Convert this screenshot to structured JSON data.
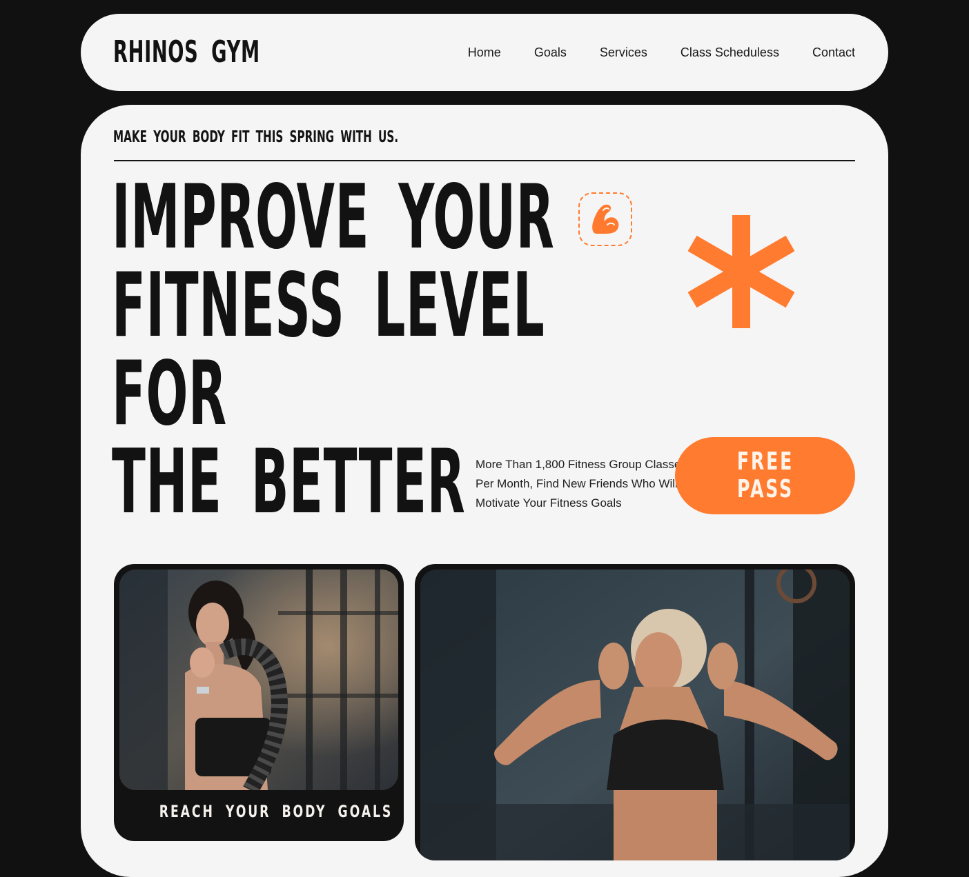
{
  "brand": {
    "name": "RHINOS GYM"
  },
  "nav": {
    "links": [
      "Home",
      "Goals",
      "Services",
      "Class Scheduless",
      "Contact"
    ]
  },
  "hero": {
    "tagline": "MAKE YOUR BODY FIT THIS SPRING WITH US.",
    "headline": [
      "IMPROVE YOUR",
      "FITNESS LEVEL",
      "FOR",
      "THE BETTER"
    ],
    "description": "More Than 1,800 Fitness Group Classes Per Month, Find New Friends Who Will Motivate Your Fitness Goals",
    "cta_label": "FREE PASS"
  },
  "cards": [
    {
      "caption": "REACH YOUR BODY GOALS",
      "photo": "woman-with-battle-rope-photo"
    },
    {
      "photo": "woman-stretching-arms-photo"
    }
  ],
  "colors": {
    "background": "#111112",
    "surface": "#f6f5f6",
    "accent": "#ff7b30",
    "text": "#121212"
  },
  "icons": [
    "flexed-bicep-icon",
    "asterisk-icon"
  ]
}
